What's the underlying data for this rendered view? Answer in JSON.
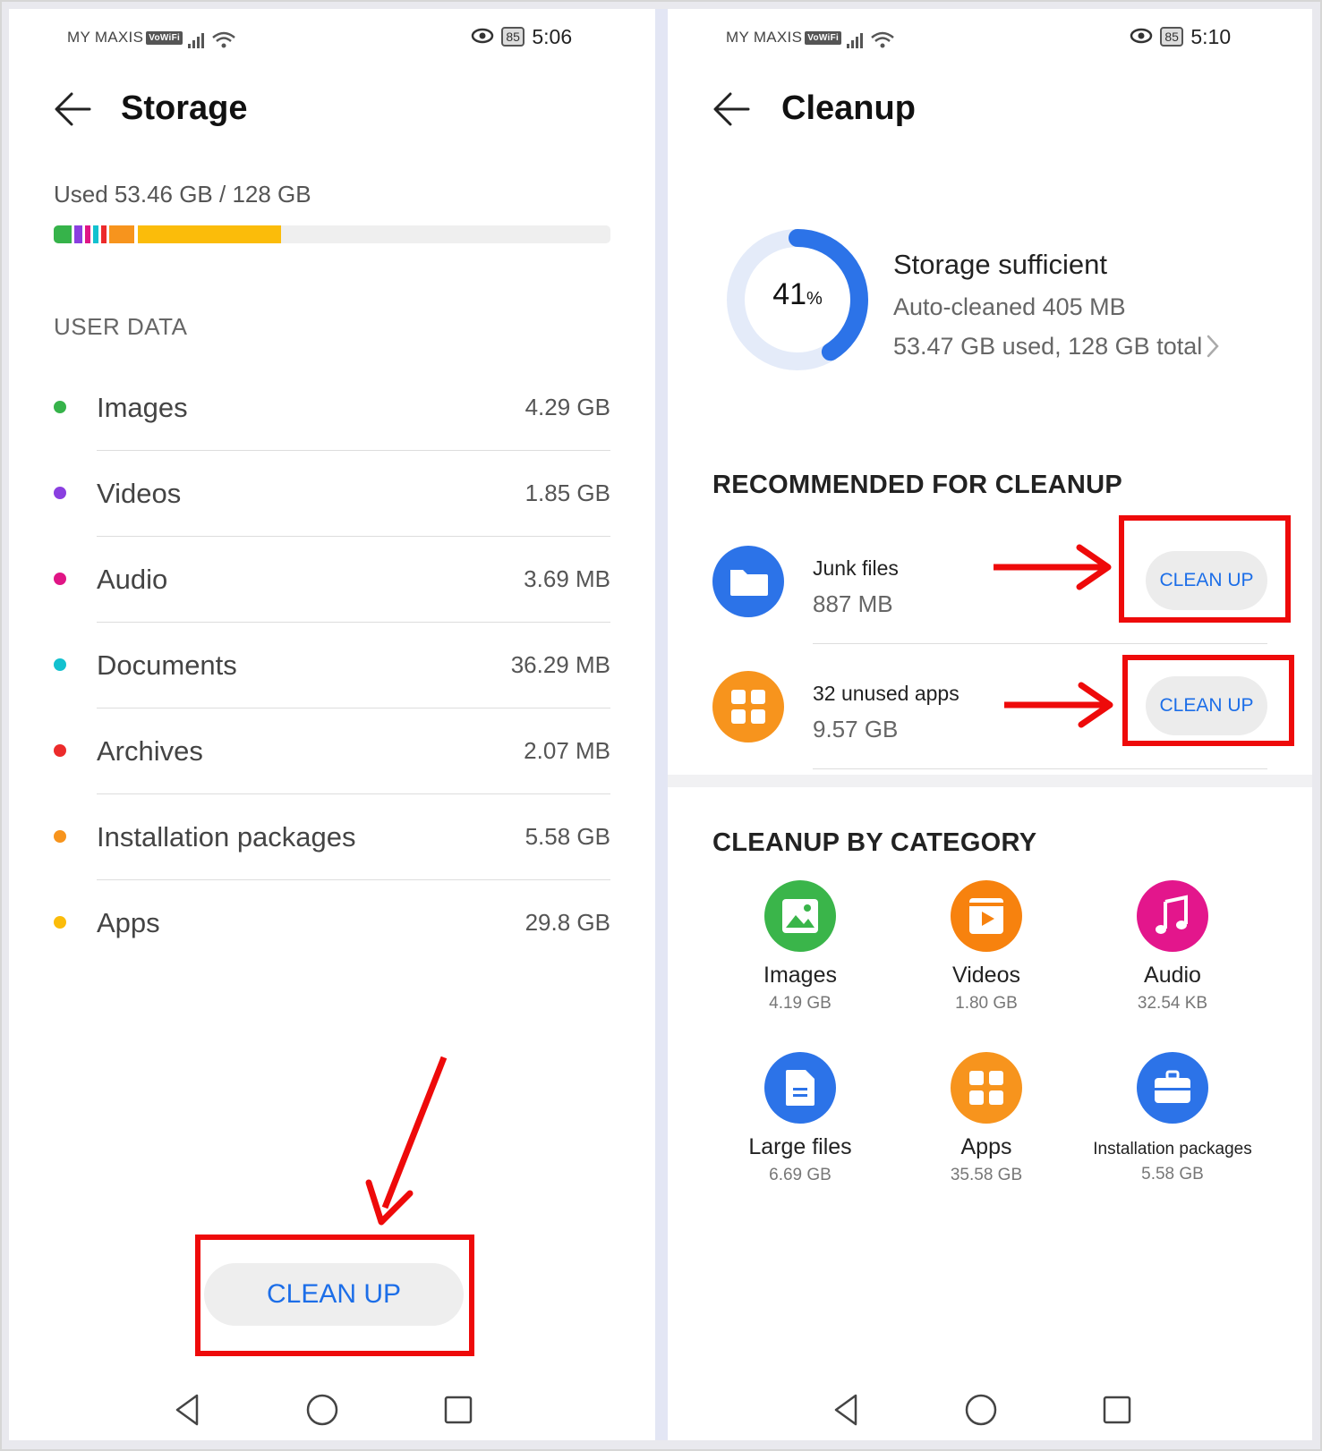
{
  "left": {
    "status": {
      "carrier": "MY MAXIS",
      "vowifi": "VoWiFi",
      "battery": "85",
      "time": "5:06"
    },
    "title": "Storage",
    "used_label": "Used 53.46 GB / 128 GB",
    "section_label": "USER DATA",
    "categories": [
      {
        "name": "Images",
        "size": "4.29 GB",
        "color": "#36b34a"
      },
      {
        "name": "Videos",
        "size": "1.85 GB",
        "color": "#8a3fe0"
      },
      {
        "name": "Audio",
        "size": "3.69 MB",
        "color": "#e01585"
      },
      {
        "name": "Documents",
        "size": "36.29 MB",
        "color": "#13c1cf"
      },
      {
        "name": "Archives",
        "size": "2.07 MB",
        "color": "#ec2b2b"
      },
      {
        "name": "Installation packages",
        "size": "5.58 GB",
        "color": "#f7941d"
      },
      {
        "name": "Apps",
        "size": "29.8 GB",
        "color": "#fbbc0a"
      }
    ],
    "cleanup_label": "CLEAN UP"
  },
  "right": {
    "status": {
      "carrier": "MY MAXIS",
      "vowifi": "VoWiFi",
      "battery": "85",
      "time": "5:10"
    },
    "title": "Cleanup",
    "percent": "41",
    "percent_sign": "%",
    "percent_value": 0.41,
    "storage_status": "Storage sufficient",
    "auto_cleaned": "Auto-cleaned 405 MB",
    "used_total": "53.47 GB used, 128 GB total",
    "recommended_title": "RECOMMENDED FOR CLEANUP",
    "recommended": [
      {
        "name": "Junk files",
        "size": "887 MB",
        "button": "CLEAN UP",
        "icon": "folder-icon",
        "color": "#2c73e8"
      },
      {
        "name": "32 unused apps",
        "size": "9.57 GB",
        "button": "CLEAN UP",
        "icon": "apps-grid-icon",
        "color": "#f7941d"
      }
    ],
    "category_title": "CLEANUP BY CATEGORY",
    "grid": [
      {
        "name": "Images",
        "size": "4.19 GB",
        "icon": "image-icon",
        "color": "#3ab54a"
      },
      {
        "name": "Videos",
        "size": "1.80 GB",
        "icon": "video-icon",
        "color": "#f7820e"
      },
      {
        "name": "Audio",
        "size": "32.54 KB",
        "icon": "music-note-icon",
        "color": "#e3168c"
      },
      {
        "name": "Large files",
        "size": "6.69 GB",
        "icon": "document-icon",
        "color": "#2c73e8"
      },
      {
        "name": "Apps",
        "size": "35.58 GB",
        "icon": "apps-grid-icon",
        "color": "#f7941d"
      },
      {
        "name": "Installation packages",
        "size": "5.58 GB",
        "icon": "briefcase-icon",
        "color": "#2c73e8"
      }
    ]
  }
}
